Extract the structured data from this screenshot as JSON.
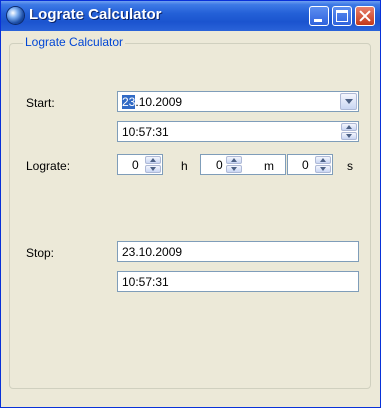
{
  "window": {
    "title": "Lograte Calculator",
    "icon": "app-globe-icon"
  },
  "titlebar_buttons": [
    "minimize-icon",
    "maximize-icon",
    "close-icon"
  ],
  "group": {
    "legend": "Lograte Calculator"
  },
  "start": {
    "label": "Start:",
    "date_selected": "23",
    "date_rest": ".10.2009",
    "time": "10:57:31"
  },
  "lograte": {
    "label": "Lograte:",
    "hours": "0",
    "hours_unit": "h",
    "minutes": "0",
    "minutes_unit": "m",
    "seconds": "0",
    "seconds_unit": "s"
  },
  "stop": {
    "label": "Stop:",
    "date": "23.10.2009",
    "time": "10:57:31"
  },
  "colors": {
    "titlebar": "#2461d8",
    "legend_text": "#0046d5",
    "selection": "#316ac5",
    "close_button": "#c3391a",
    "dialog_bg": "#ece9d8"
  }
}
